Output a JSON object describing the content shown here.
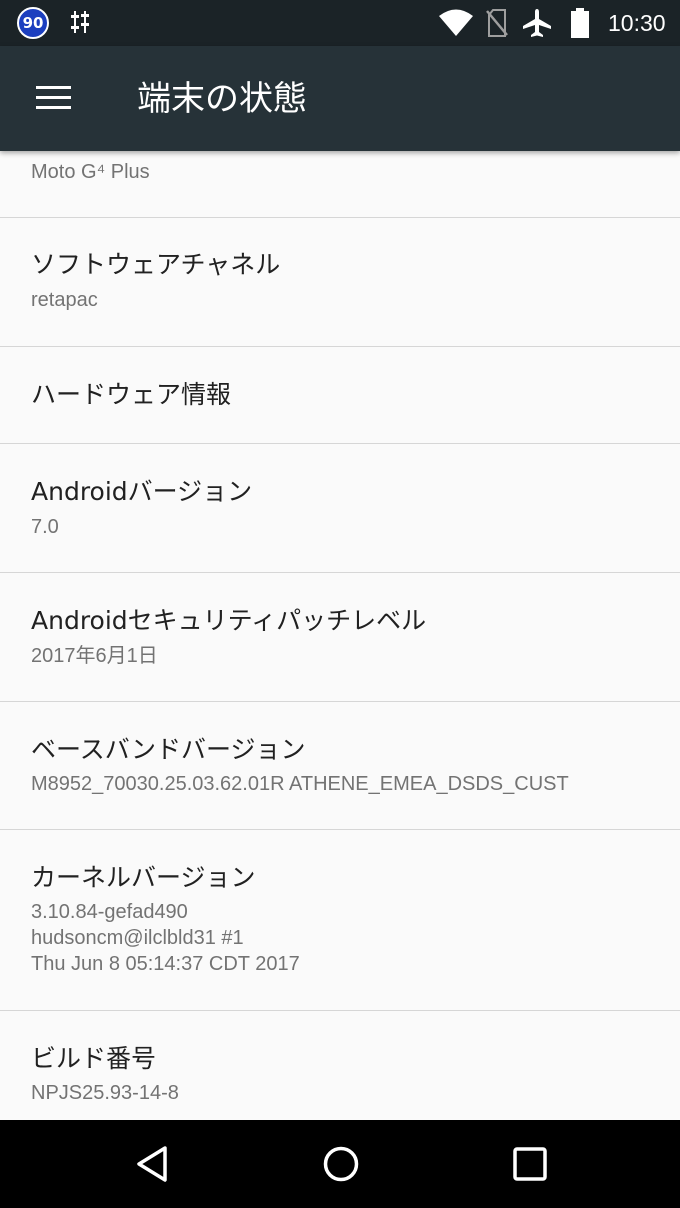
{
  "status_bar": {
    "badge": "90",
    "time": "10:30",
    "icons": [
      "tune-icon",
      "wifi-icon",
      "no-sim-icon",
      "airplane-icon",
      "battery-icon"
    ]
  },
  "app_bar": {
    "title": "端末の状態",
    "menu_icon": "hamburger-menu-icon"
  },
  "rows": {
    "model": {
      "sub": "Moto G⁴ Plus"
    },
    "software_channel": {
      "title": "ソフトウェアチャネル",
      "sub": "retapac"
    },
    "hardware_info": {
      "title": "ハードウェア情報"
    },
    "android_version": {
      "title": "Androidバージョン",
      "sub": "7.0"
    },
    "security_patch": {
      "title": "Androidセキュリティパッチレベル",
      "sub": "2017年6月1日"
    },
    "baseband": {
      "title": "ベースバンドバージョン",
      "sub": "M8952_70030.25.03.62.01R ATHENE_EMEA_DSDS_CUST"
    },
    "kernel": {
      "title": "カーネルバージョン",
      "sub_line1": "3.10.84-gefad490",
      "sub_line2": "hudsoncm@ilclbld31 #1",
      "sub_line3": "Thu Jun 8 05:14:37 CDT 2017"
    },
    "build": {
      "title": "ビルド番号",
      "sub": "NPJS25.93-14-8"
    }
  },
  "nav_bar": {
    "icons": [
      "back-icon",
      "home-icon",
      "recents-icon"
    ]
  },
  "colors": {
    "status_bar": "#1b2327",
    "app_bar": "#263238",
    "background": "#fafafa",
    "title_text": "#212121",
    "sub_text": "#737373",
    "divider": "#d6d6d6"
  }
}
